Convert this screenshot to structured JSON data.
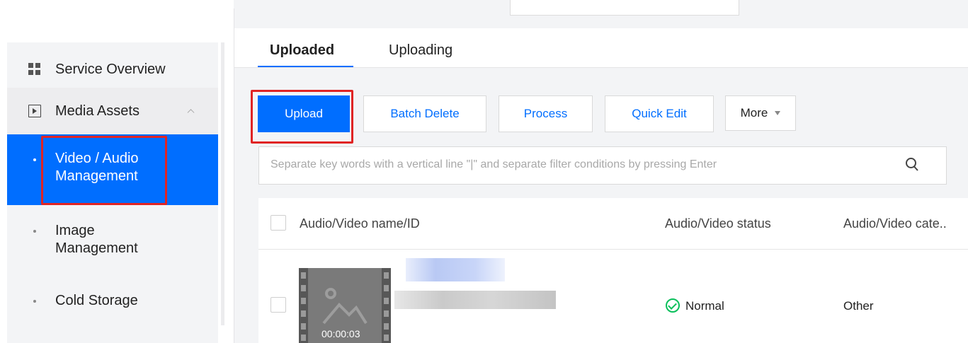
{
  "sidebar": {
    "service_overview": "Service Overview",
    "media_assets": "Media Assets",
    "video_audio": [
      "Video / Audio",
      "Management"
    ],
    "image_mgmt": [
      "Image",
      "Management"
    ],
    "cold_storage": "Cold Storage"
  },
  "tabs": {
    "uploaded": "Uploaded",
    "uploading": "Uploading"
  },
  "toolbar": {
    "upload": "Upload",
    "batch_delete": "Batch Delete",
    "process": "Process",
    "quick_edit": "Quick Edit",
    "more": "More"
  },
  "search": {
    "placeholder": "Separate key words with a vertical line \"|\" and separate filter conditions by pressing Enter"
  },
  "table": {
    "headers": [
      "Audio/Video name/ID",
      "Audio/Video status",
      "Audio/Video cate.."
    ],
    "rows": [
      {
        "duration": "00:00:03",
        "status": "Normal",
        "category": "Other"
      }
    ]
  },
  "colors": {
    "accent": "#006eff",
    "highlight": "#e02424",
    "success": "#0abf5b"
  }
}
